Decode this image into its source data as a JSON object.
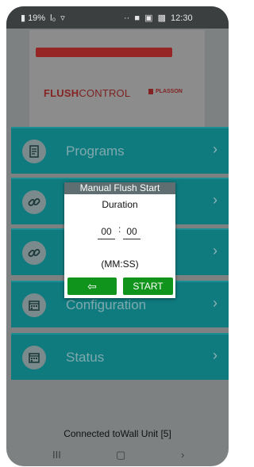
{
  "status_bar": {
    "battery": "19%",
    "signal": "l₀",
    "wifi": "▿",
    "dots": "··",
    "time": "12:30",
    "notification_icons": [
      "chat-icon",
      "mail-icon",
      "image-icon"
    ]
  },
  "logo": {
    "brand_bold": "FLUSH",
    "brand_light": "CONTROL",
    "partner": "PLASSON"
  },
  "menu": {
    "items": [
      {
        "label": "Programs",
        "icon": "document-icon"
      },
      {
        "label": "",
        "icon": "link-icon"
      },
      {
        "label": "",
        "icon": "link-icon"
      },
      {
        "label": "Configuration",
        "icon": "calendar-icon"
      },
      {
        "label": "Status",
        "icon": "calendar-icon"
      }
    ],
    "chevron": "›"
  },
  "dialog": {
    "title": "Manual Flush Start",
    "duration_label": "Duration",
    "minutes": "00",
    "separator": ":",
    "seconds": "00",
    "format_label": "(MM:SS)",
    "back_label": "⇦",
    "start_label": "START"
  },
  "footer": {
    "connection_text": "Connected toWall Unit [5]"
  },
  "nav": {
    "recents": "III",
    "home": "▢",
    "back": "›"
  },
  "colors": {
    "menu_bg": "#0f7b7f",
    "button_green": "#11941b",
    "dialog_title_bg": "#5e6e71"
  }
}
